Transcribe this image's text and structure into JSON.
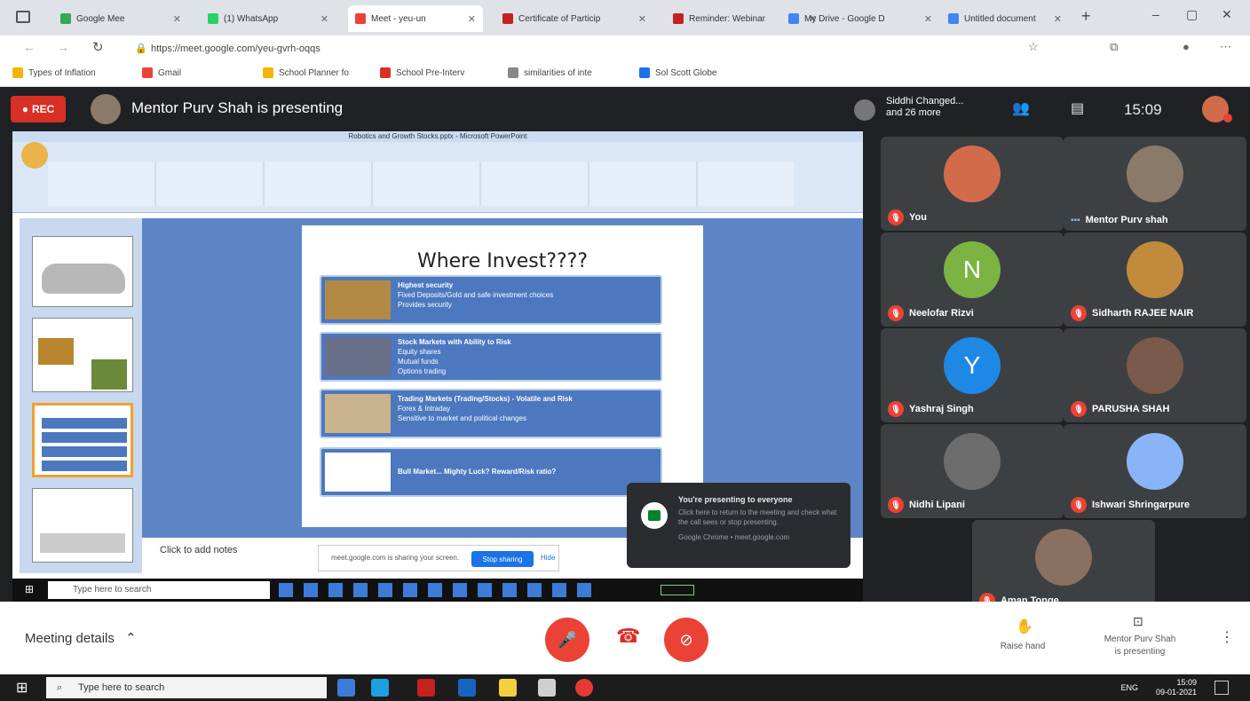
{
  "browser": {
    "tabs": [
      {
        "label": "Google Mee",
        "color": "#34a853",
        "active": false
      },
      {
        "label": "(1) WhatsApp",
        "color": "#25d366",
        "active": false
      },
      {
        "label": "Meet - yeu-un",
        "color": "#ea4335",
        "active": true
      },
      {
        "label": "Certificate of Particip",
        "color": "#c5221f",
        "active": false
      },
      {
        "label": "Reminder: Webinar",
        "color": "#c5221f",
        "active": false
      },
      {
        "label": "My Drive - Google D",
        "color": "#4285f4",
        "active": false
      },
      {
        "label": "Untitled document",
        "color": "#4285f4",
        "active": false
      }
    ],
    "url": "https://meet.google.com/yeu-gvrh-oqqs",
    "bookmarks": [
      {
        "label": "Types of Inflation",
        "color": "#f4b400"
      },
      {
        "label": "Gmail",
        "color": "#ea4335"
      },
      {
        "label": "School Planner fo",
        "color": "#f4b400"
      },
      {
        "label": "School Pre-Interv",
        "color": "#d93025"
      },
      {
        "label": "similarities of inte",
        "color": "#888888"
      },
      {
        "label": "Sol Scott Globe",
        "color": "#1a73e8"
      }
    ]
  },
  "meet": {
    "rec_label": "REC",
    "presenting_title": "Mentor Purv Shah is presenting",
    "others_line1": "Siddhi Changed...",
    "others_line2": "and 26 more",
    "clock": "15:09",
    "participants": [
      {
        "name": "You",
        "muted": true,
        "avatar_type": "photo",
        "avatar_color": "#d26b4a",
        "initial": ""
      },
      {
        "name": "Mentor Purv shah",
        "muted": false,
        "avatar_type": "photo",
        "avatar_color": "#8b7a6a",
        "initial": ""
      },
      {
        "name": "Neelofar Rizvi",
        "muted": true,
        "avatar_type": "initial",
        "avatar_color": "#7cb342",
        "initial": "N"
      },
      {
        "name": "Sidharth RAJEE NAIR",
        "muted": true,
        "avatar_type": "photo",
        "avatar_color": "#c28a3c",
        "initial": ""
      },
      {
        "name": "Yashraj Singh",
        "muted": true,
        "avatar_type": "initial",
        "avatar_color": "#1e88e5",
        "initial": "Y"
      },
      {
        "name": "PARUSHA SHAH",
        "muted": true,
        "avatar_type": "photo",
        "avatar_color": "#7a5a4a",
        "initial": ""
      },
      {
        "name": "Nidhi Lipani",
        "muted": true,
        "avatar_type": "photo",
        "avatar_color": "#6c6c6c",
        "initial": ""
      },
      {
        "name": "Ishwari Shringarpure",
        "muted": true,
        "avatar_type": "photo",
        "avatar_color": "#8ab4f8",
        "initial": ""
      },
      {
        "name": "Aman Tonge",
        "muted": true,
        "avatar_type": "photo",
        "avatar_color": "#8a7060",
        "initial": ""
      }
    ]
  },
  "share": {
    "ppt_title": "Robotics and Growth Stocks.pptx - Microsoft PowerPoint",
    "slide_title": "Where Invest????",
    "rows": [
      {
        "heading": "Highest security",
        "lines": [
          "Fixed Deposits/Gold and safe investment choices",
          "Provides security"
        ],
        "img_color": "#b38a45"
      },
      {
        "heading": "Stock Markets with Ability to Risk",
        "lines": [
          "Equity shares",
          "Mutual funds",
          "Options trading"
        ],
        "img_color": "#6a6f8a"
      },
      {
        "heading": "Trading Markets (Trading/Stocks) - Volatile and Risk",
        "lines": [
          "Forex & Intraday",
          "Sensitive to market and political changes"
        ],
        "img_color": "#c9b48c"
      },
      {
        "heading": "Bull Market... Mighty Luck? Reward/Risk ratio?",
        "lines": [],
        "img_color": "#ffffff"
      }
    ],
    "notes_placeholder": "Click to add notes",
    "popup_title": "You're presenting to everyone",
    "popup_body": "Click here to return to the meeting and check what the call sees or stop presenting.",
    "popup_footer": "Google Chrome • meet.google.com",
    "pause_text": "meet.google.com is sharing your screen.",
    "stop_sharing": "Stop sharing",
    "hide": "Hide",
    "inner_search": "Type here to search"
  },
  "controls": {
    "meeting_details": "Meeting details",
    "raise_hand": "Raise hand",
    "presenting_label_1": "Mentor Purv Shah",
    "presenting_label_2": "is presenting"
  },
  "taskbar": {
    "search_placeholder": "Type here to search",
    "time": "15:09",
    "date": "09-01-2021",
    "lang": "ENG"
  }
}
